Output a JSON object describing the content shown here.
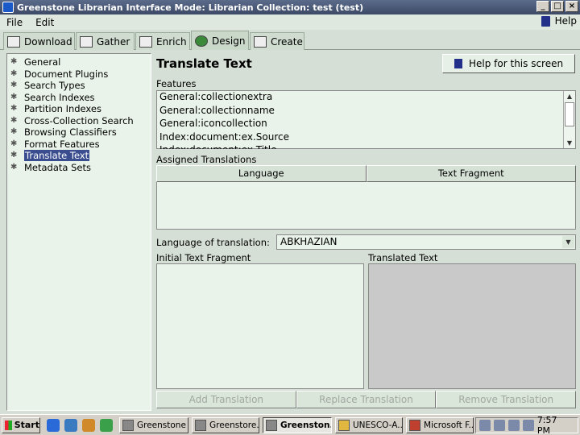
{
  "window": {
    "title": "Greenstone Librarian Interface  Mode: Librarian  Collection: test (test)",
    "controls": [
      "_",
      "□",
      "×"
    ]
  },
  "menu": {
    "file": "File",
    "edit": "Edit",
    "help": "Help"
  },
  "tabs": [
    {
      "label": "Download"
    },
    {
      "label": "Gather"
    },
    {
      "label": "Enrich"
    },
    {
      "label": "Design",
      "active": true
    },
    {
      "label": "Create"
    }
  ],
  "sidebar": {
    "items": [
      {
        "label": "General"
      },
      {
        "label": "Document Plugins"
      },
      {
        "label": "Search Types"
      },
      {
        "label": "Search Indexes"
      },
      {
        "label": "Partition Indexes"
      },
      {
        "label": "Cross-Collection Search"
      },
      {
        "label": "Browsing Classifiers"
      },
      {
        "label": "Format Features"
      },
      {
        "label": "Translate Text",
        "selected": true
      },
      {
        "label": "Metadata Sets"
      }
    ]
  },
  "main": {
    "title": "Translate Text",
    "help_button": "Help for this screen",
    "features_label": "Features",
    "features": [
      "General:collectionextra",
      "General:collectionname",
      "General:iconcollection",
      "Index:document:ex.Source",
      "Index:document:ex.Title"
    ],
    "assigned_label": "Assigned Translations",
    "columns": [
      "Language",
      "Text Fragment"
    ],
    "language_label": "Language of translation:",
    "language_value": "ABKHAZIAN",
    "initial_label": "Initial Text Fragment",
    "translated_label": "Translated Text",
    "buttons": {
      "add": "Add Translation",
      "replace": "Replace Translation",
      "remove": "Remove Translation"
    }
  },
  "taskbar": {
    "start": "Start",
    "tasks": [
      {
        "label": "Greenstone ..."
      },
      {
        "label": "Greenstore..."
      },
      {
        "label": "Greenston...",
        "active": true
      },
      {
        "label": "UNESCO-A..."
      },
      {
        "label": "Microsoft F..."
      }
    ],
    "clock": "7:57 PM"
  }
}
